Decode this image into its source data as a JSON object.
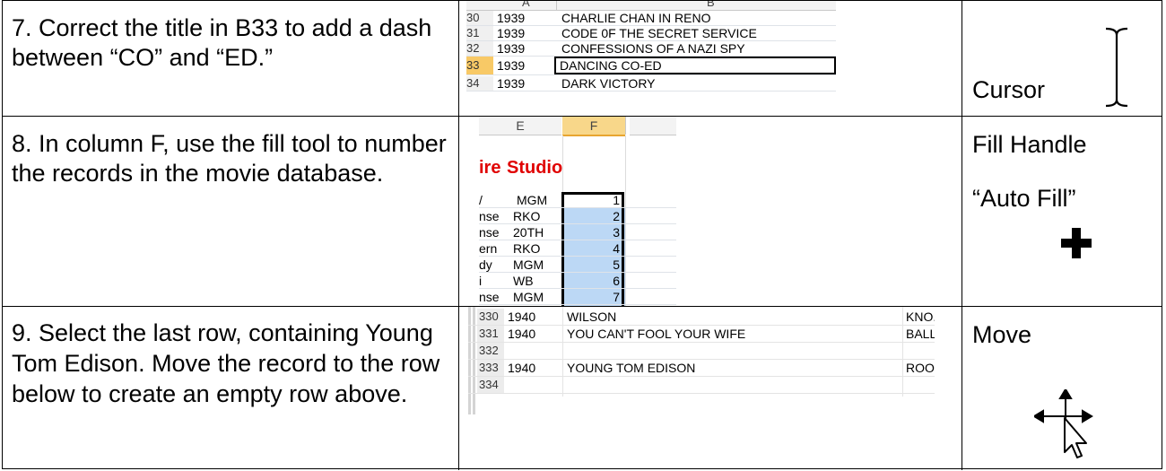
{
  "rows": [
    {
      "instruction": "7. Correct the title in B33 to add a dash between “CO” and “ED.”",
      "label": "Cursor",
      "sheet": {
        "col_a": "A",
        "col_b": "B",
        "records": [
          {
            "row": "30",
            "year": "1939",
            "title": "CHARLIE CHAN IN RENO"
          },
          {
            "row": "31",
            "year": "1939",
            "title": "CODE 0F THE SECRET SERVICE"
          },
          {
            "row": "32",
            "year": "1939",
            "title": "CONFESSIONS OF A NAZI SPY"
          },
          {
            "row": "33",
            "year": "1939",
            "title": "DANCING CO-ED"
          },
          {
            "row": "34",
            "year": "1939",
            "title": "DARK VICTORY"
          }
        ]
      }
    },
    {
      "instruction": "8. In column F, use the fill tool to number the records in the movie database.",
      "label1": "Fill Handle",
      "label2": "“Auto Fill”",
      "sheet": {
        "col_e": "E",
        "col_f": "F",
        "header_partial": "ire",
        "header_studio": "Studio",
        "records": [
          {
            "genre": "/",
            "studio": "MGM",
            "num": "1"
          },
          {
            "genre": "nse",
            "studio": "RKO",
            "num": "2"
          },
          {
            "genre": "nse",
            "studio": "20TH",
            "num": "3"
          },
          {
            "genre": "ern",
            "studio": "RKO",
            "num": "4"
          },
          {
            "genre": "dy",
            "studio": "MGM",
            "num": "5"
          },
          {
            "genre": "i",
            "studio": "WB",
            "num": "6"
          },
          {
            "genre": "nse",
            "studio": "MGM",
            "num": "7"
          }
        ]
      }
    },
    {
      "instruction": "9. Select the last row, containing Young Tom Edison. Move the record to the row below to create an empty row above.",
      "label": "Move",
      "sheet": {
        "records": [
          {
            "row": "330",
            "year": "1940",
            "title": "WILSON",
            "extra": "KNO."
          },
          {
            "row": "331",
            "year": "1940",
            "title": "YOU CAN'T FOOL YOUR WIFE",
            "extra": "BALL"
          },
          {
            "row": "332",
            "year": "",
            "title": "",
            "extra": ""
          },
          {
            "row": "333",
            "year": "1940",
            "title": "YOUNG TOM EDISON",
            "extra": "ROO"
          },
          {
            "row": "334",
            "year": "",
            "title": "",
            "extra": ""
          }
        ]
      }
    }
  ],
  "colors": {
    "selection_fill": "#bcd8f5",
    "active_header": "#f8c966",
    "studio_header": "#e00000"
  }
}
